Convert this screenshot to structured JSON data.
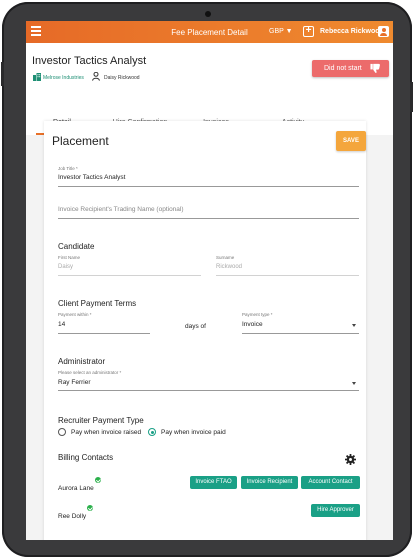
{
  "topbar": {
    "title": "Fee Placement Detail",
    "currency": "GBP ▼",
    "add_icon": "plus-icon",
    "user_name": "Rebecca Rickwood",
    "user_icon": "user-icon"
  },
  "header": {
    "job_title": "Investor Tactics Analyst",
    "company": "Melrose Industries",
    "company_icon": "building-icon",
    "person": "Daisy Rickwood",
    "person_icon": "person-icon",
    "status_label": "Did not start",
    "status_icon": "thumbs-down-icon",
    "status_color": "#ec6b6b"
  },
  "tabs": [
    {
      "label": "Detail",
      "active": true
    },
    {
      "label": "Hire Confirmation",
      "active": false
    },
    {
      "label": "Invoices",
      "active": false
    },
    {
      "label": "Activity",
      "active": false
    }
  ],
  "placement": {
    "heading": "Placement",
    "save_label": "SAVE",
    "job_title_label": "Job Title *",
    "job_title_value": "Investor Tactics Analyst",
    "invoice_recipient_placeholder": "Invoice Recipient's Trading Name (optional)"
  },
  "candidate": {
    "heading": "Candidate",
    "first_name_label": "First Name",
    "first_name_value": "Daisy",
    "surname_label": "Surname",
    "surname_value": "Rickwood"
  },
  "payment_terms": {
    "heading": "Client Payment Terms",
    "payment_within_label": "Payment within *",
    "payment_within_value": "14",
    "days_of": "days of",
    "payment_type_label": "Payment type *",
    "payment_type_value": "Invoice"
  },
  "administrator": {
    "heading": "Administrator",
    "select_label": "Please select an administrator *",
    "value": "Ray Ferrier"
  },
  "recruiter_payment": {
    "heading": "Recruiter Payment Type",
    "options": [
      {
        "label": "Pay when invoice raised",
        "selected": false
      },
      {
        "label": "Pay when invoice paid",
        "selected": true
      }
    ]
  },
  "billing": {
    "heading": "Billing Contacts",
    "settings_icon": "gear-icon",
    "contacts": [
      {
        "name": "Aurora Lane",
        "buttons": [
          "Invoice FTAO",
          "Invoice Recipient",
          "Account Contact"
        ]
      },
      {
        "name": "Ree Dolly",
        "buttons": [
          "Hire Approver"
        ]
      }
    ],
    "accent_color": "#1aa086"
  },
  "colors": {
    "topbar": "#e66a27",
    "save": "#f4a63c"
  }
}
